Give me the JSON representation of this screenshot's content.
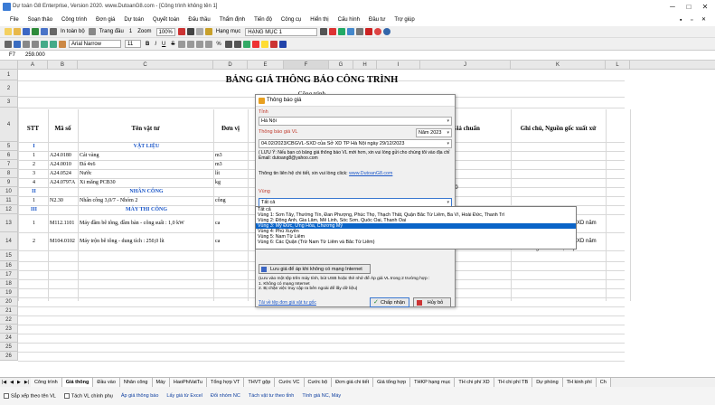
{
  "app": {
    "title": "Dự toán G8 Enterprise, Version 2020.  www.DutoanG8.com  - [Công trình không tên 1]"
  },
  "window_controls": {
    "minimize": "─",
    "maximize": "□",
    "close": "✕",
    "inner_minimize": "▪",
    "inner_restore": "▫",
    "inner_close": "✕"
  },
  "menu": [
    "File",
    "Soạn thảo",
    "Công trình",
    "Đơn giá",
    "Dự toán",
    "Quyết toán",
    "Đấu thầu",
    "Thẩm định",
    "Tiến độ",
    "Công cụ",
    "Hiển thị",
    "Cấu hình",
    "Đầu tư",
    "Trợ giúp"
  ],
  "toolbar1": {
    "print_table": "In toàn bộ",
    "page_label": "Trang đầu",
    "page_value": "1",
    "zoom_label": "Zoom",
    "zoom_value": "100%",
    "category_label": "Hạng mục",
    "category_value": "HẠNG MỤC 1"
  },
  "toolbar2": {
    "font_name": "Arial Narrow",
    "font_size": "11",
    "bold": "B",
    "italic": "I",
    "underline": "U",
    "strike": "S",
    "percent": "%"
  },
  "formula_bar": {
    "cell_ref": "F7",
    "value": "259.000"
  },
  "columns": [
    "A",
    "B",
    "C",
    "D",
    "E",
    "F",
    "G",
    "H",
    "I",
    "J",
    "K",
    "L"
  ],
  "rows": [
    "1",
    "2",
    "3",
    "4",
    "5",
    "6",
    "7",
    "8",
    "9",
    "10",
    "11",
    "12",
    "13",
    "14",
    "15",
    "16",
    "17",
    "18",
    "19",
    "20",
    "21",
    "22",
    "23",
    "24",
    "25",
    "26"
  ],
  "sheet": {
    "title": "BẢNG GIÁ THÔNG BÁO CÔNG TRÌNH",
    "subtitle": "Công trình",
    "headers": {
      "stt": "STT",
      "code": "Mã số",
      "name": "Tên vật tư",
      "unit": "Đơn vị",
      "std": "Giá chuẩn",
      "note": "Ghi chú, Nguồn gốc xuất xứ"
    },
    "data_rows": [
      {
        "stt": "I",
        "code": "",
        "name": "VẬT LIỆU",
        "unit": "",
        "section": true
      },
      {
        "stt": "1",
        "code": "A24.0180",
        "name": "Cát vàng",
        "unit": "m3"
      },
      {
        "stt": "2",
        "code": "A24.0010",
        "name": "Đá 4x6",
        "unit": "m3"
      },
      {
        "stt": "3",
        "code": "A24.0524",
        "name": "Nước",
        "unit": "lít"
      },
      {
        "stt": "4",
        "code": "A24.0797A",
        "name": "Xi măng PCB30",
        "unit": "kg"
      },
      {
        "stt": "II",
        "code": "",
        "name": "NHÂN CÔNG",
        "unit": "",
        "section": true
      },
      {
        "stt": "1",
        "code": "N2.30",
        "name": "Nhân công 3,0/7 - Nhóm 2",
        "unit": "công"
      },
      {
        "stt": "III",
        "code": "",
        "name": "MÁY THI CÔNG",
        "unit": "",
        "section": true
      },
      {
        "stt": "1",
        "code": "M112.1101",
        "name": "Máy đầm bê tông, đầm bàn - công suất : 1,0 kW",
        "unit": "ca"
      },
      {
        "stt": "2",
        "code": "M104.0102",
        "name": "Máy trộn bê tông - dung tích : 250,0 lít",
        "unit": "ca"
      }
    ],
    "partial_values": {
      "row9_j": "30",
      "row13_k": "XD năm",
      "row14_k": "XD năm",
      "row14_k2": "2023 Vùng 1 - Khu vực 1)"
    }
  },
  "dialog": {
    "title": "Thông báo giá",
    "province_label": "Tỉnh",
    "province_value": "Hà Nội",
    "year_value": "Năm 2023",
    "price_label": "Thông báo giá VL",
    "price_value": "04.02/2023/CBGVL-SXD của Sở XD TP Hà Nội ngày 29/12/2023",
    "note": "( LƯU Ý: Nếu bạn có bảng giá thông báo VL mới hơn, xin vui lòng gửi cho chúng tôi vào địa chỉ Email:  dutoang8@yahoo.com",
    "contact_text": "Thông tin liên hệ chi tiết, xin vui lòng click: ",
    "contact_link": "www.DutoanG8.com",
    "region_label": "Vùng",
    "region_value": "Tất cả",
    "save_button": "Lưu giá để áp khi không có mạng Internet",
    "save_note": "(Lưu vào một tệp trên máy tính, bút USB hoặc thẻ nhớ để Áp giá VL trong 2 trường hợp :\n1. Không có mạng Internet\n2. Bị chặn việc truy cập ra bên ngoài để lấy dữ liệu)",
    "download_link": "Tải về tệp đơn giá vật tư gốc",
    "accept": "Chấp nhận",
    "cancel": "Hủy bỏ"
  },
  "region_options": [
    "Tất cả",
    "Vùng 1: Sơn Tây, Thường Tín, Đan Phượng, Phúc Thọ, Thạch Thất, Quận Bắc Từ Liêm, Ba Vì, Hoài Đức, Thanh Trì",
    "Vùng 2: Đông Anh, Gia Lâm, Mê Linh, Sóc Sơn, Quốc Oai, Thanh Oai",
    "Vùng 3: Mỹ Đức, Ứng Hòa, Chương Mỹ",
    "Vùng 4: Phú Xuyên",
    "Vùng 5: Nam Từ Liêm",
    "Vùng 6: Các Quận (Trừ Nam Từ Liêm và Bắc Từ Liêm)"
  ],
  "region_selected_index": 3,
  "sheet_tabs": [
    "Công trình",
    "Giá thông",
    "Đầu vào",
    "Nhân công",
    "Máy",
    "HaoPhiVatTu",
    "Tổng hợp VT",
    "THVT gộp",
    "Cước VC",
    "Cước bộ",
    "Đơn giá chi tiết",
    "Giá tổng hợp",
    "THKP hạng mục",
    "TH chi phí XD",
    "TH chi phí TB",
    "Dự phòng",
    "TH kinh phí",
    "Ch"
  ],
  "active_tab": "Giá thông",
  "bottom_bar": [
    "Sắp xếp theo tên VL",
    "Tách VL chính phụ",
    "Áp giá thông báo",
    "Lấy giá từ Excel",
    "Đổi nhóm NC",
    "Tách vật tư theo tỉnh",
    "Tính giá NC, Máy"
  ],
  "colors": {
    "accent_blue": "#0a64c8",
    "section_blue": "#1a56c8",
    "dialog_bg": "#f0f0f0",
    "label_red": "#c0392b"
  }
}
